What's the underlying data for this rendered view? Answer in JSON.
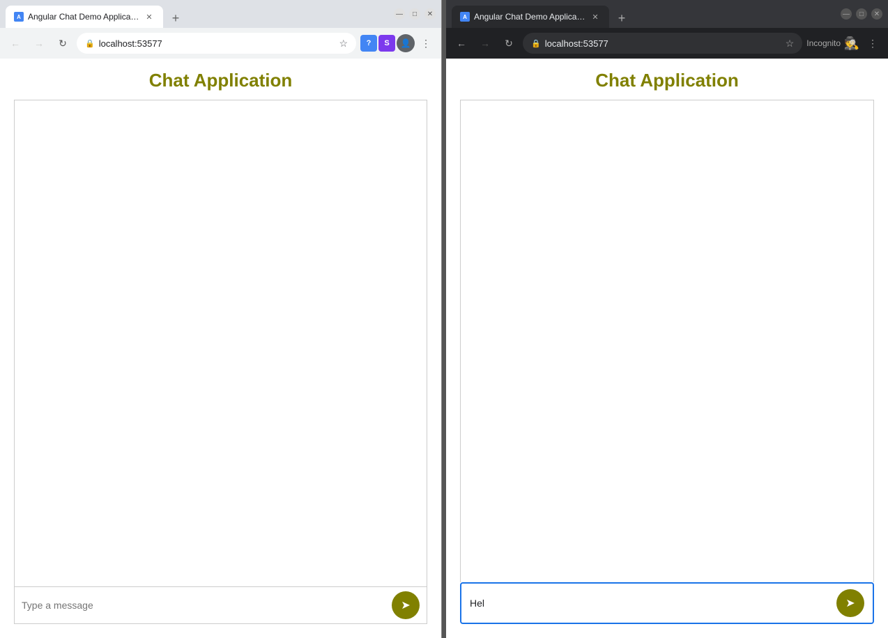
{
  "left_window": {
    "tab": {
      "label": "Angular Chat Demo Application",
      "favicon_text": "A"
    },
    "addressbar": {
      "url": "localhost:53577",
      "back_label": "←",
      "forward_label": "→",
      "reload_label": "↻"
    },
    "page": {
      "title": "Chat Application",
      "input_placeholder": "Type a message",
      "send_button_label": "➤"
    }
  },
  "right_window": {
    "tab": {
      "label": "Angular Chat Demo Application",
      "favicon_text": "A"
    },
    "addressbar": {
      "url": "localhost:53577",
      "back_label": "←",
      "forward_label": "→",
      "reload_label": "↻",
      "incognito_label": "Incognito"
    },
    "page": {
      "title": "Chat Application",
      "input_value": "Hel",
      "send_button_label": "➤"
    }
  },
  "accent_color": "#808000",
  "active_border_color": "#1a73e8"
}
